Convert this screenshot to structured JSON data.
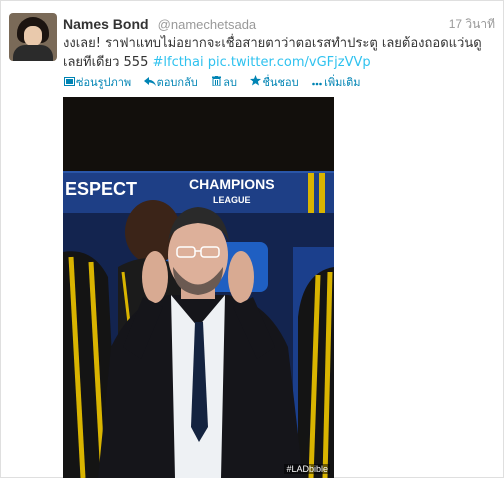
{
  "tweet": {
    "name": "Names Bond",
    "handle": "@namechetsada",
    "time": "17 วินาที",
    "text_plain": "งงเลย! ราฟาแทบไม่อยากจะเชื่อสายตาว่าตอเรสทำประตู เลยต้องถอดแว่นดูเลยทีเดียว 555 ",
    "hashtag": "#lfcthai",
    "link": "pic.twitter.com/vGFjzVVp"
  },
  "actions": [
    {
      "label": "ซ่อนรูปภาพ",
      "icon": "image-icon"
    },
    {
      "label": "ตอบกลับ",
      "icon": "reply-icon"
    },
    {
      "label": "ลบ",
      "icon": "trash-icon"
    },
    {
      "label": "ชื่นชอบ",
      "icon": "star-icon"
    },
    {
      "label": "เพิ่มเติม",
      "icon": "more-icon"
    }
  ],
  "photo": {
    "banner_left": "ESPECT",
    "banner_main": "CHAMPIONS",
    "banner_sub": "LEAGUE",
    "credit": "#LADbible"
  },
  "colors": {
    "link": "#2fc2ef",
    "action": "#0084b4",
    "muted": "#999999"
  }
}
